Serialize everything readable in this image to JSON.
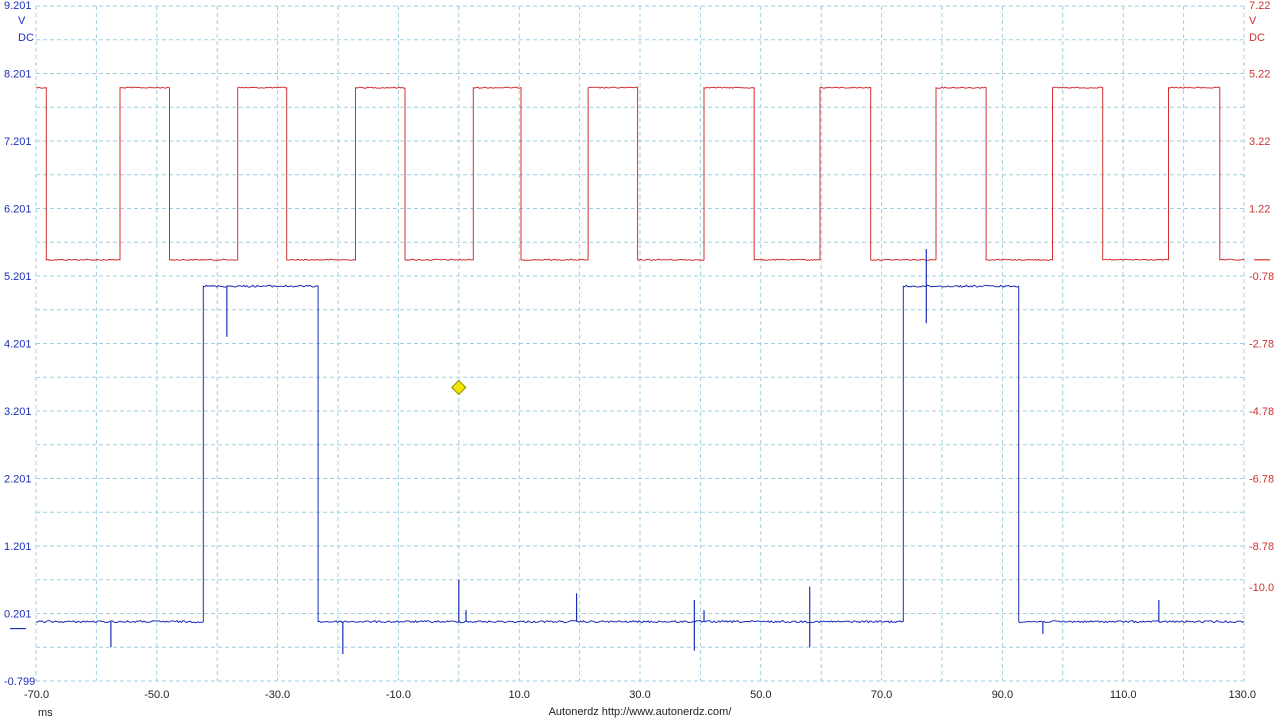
{
  "chart_data": {
    "type": "line",
    "footer": "Autonerdz  http://www.autonerdz.com/",
    "x_axis": {
      "unit": "ms",
      "range": [
        -70,
        130
      ],
      "ticks": [
        "-70.0",
        "-50.0",
        "-30.0",
        "-10.0",
        "10.0",
        "30.0",
        "50.0",
        "70.0",
        "90.0",
        "110.0",
        "130.0"
      ]
    },
    "y_left": {
      "unit": "V",
      "coupling": "DC",
      "range": [
        -0.799,
        9.201
      ],
      "ticks": [
        "9.201",
        "8.201",
        "7.201",
        "6.201",
        "5.201",
        "4.201",
        "3.201",
        "2.201",
        "1.201",
        "0.201",
        "-0.799"
      ],
      "color": "#1a2fb8"
    },
    "y_right": {
      "unit": "V",
      "coupling": "DC",
      "range": [
        -12.78,
        7.22
      ],
      "ticks": [
        "7.22",
        "5.22",
        "3.22",
        "1.22",
        "-0.78",
        "-2.78",
        "-4.78",
        "-6.78",
        "-8.78",
        "-10.0"
      ],
      "color": "#d03030"
    },
    "grid": true,
    "trigger_marker": {
      "x": 0,
      "y_left": 3.55,
      "color": "#f2e600"
    },
    "series": [
      {
        "axis": "right",
        "color": "#d03030",
        "low": -0.3,
        "high": 4.8,
        "x_start": -70,
        "x_end": 130,
        "start_level": "high",
        "transitions": [
          -68.3,
          -56.1,
          -47.9,
          -36.6,
          -28.5,
          -17.1,
          -8.9,
          2.4,
          10.3,
          21.4,
          29.6,
          40.6,
          48.9,
          59.8,
          68.2,
          79.0,
          87.3,
          98.3,
          106.6,
          117.5,
          126.0
        ]
      },
      {
        "axis": "left",
        "color": "#1a2fb8",
        "low": 0.08,
        "high": 5.05,
        "x_start": -70,
        "x_end": 130,
        "start_level": "low",
        "transitions": [
          -42.3,
          -23.3,
          73.6,
          92.7
        ],
        "spikes": [
          [
            -57.6,
            -0.3
          ],
          [
            -38.4,
            4.3
          ],
          [
            -19.2,
            -0.4
          ],
          [
            0.0,
            0.7
          ],
          [
            1.2,
            0.25
          ],
          [
            19.5,
            0.5
          ],
          [
            39.0,
            -0.35
          ],
          [
            39.0,
            0.4
          ],
          [
            40.6,
            0.25
          ],
          [
            58.1,
            0.6
          ],
          [
            58.1,
            -0.3
          ],
          [
            77.4,
            5.6
          ],
          [
            77.4,
            4.5
          ],
          [
            96.7,
            -0.1
          ],
          [
            115.9,
            0.4
          ]
        ]
      }
    ]
  }
}
